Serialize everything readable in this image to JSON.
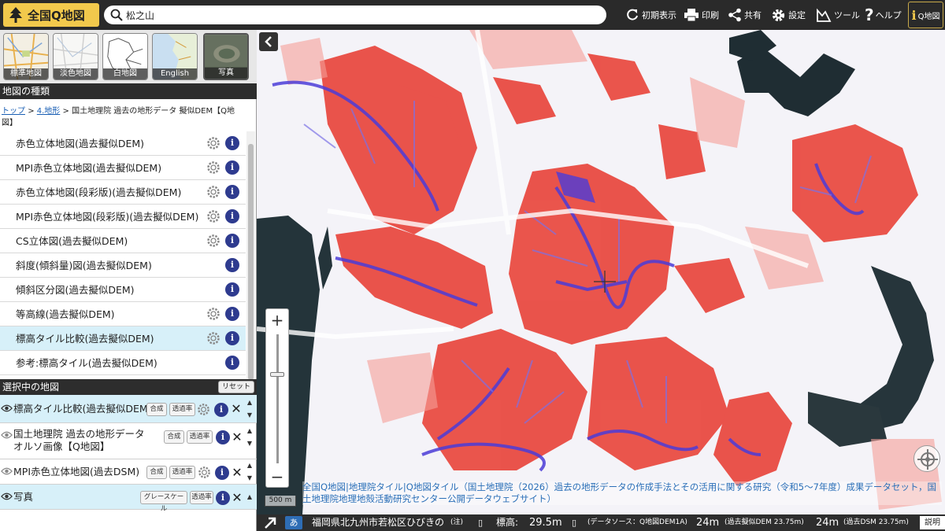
{
  "header": {
    "logo_label": "全国Q地図",
    "search_value": "松之山",
    "buttons": [
      {
        "label": "初期表示",
        "icon": "refresh-icon"
      },
      {
        "label": "印刷",
        "icon": "print-icon"
      },
      {
        "label": "共有",
        "icon": "share-icon"
      },
      {
        "label": "設定",
        "icon": "gear-icon"
      },
      {
        "label": "ツール",
        "icon": "tool-icon"
      },
      {
        "label": "ヘルプ",
        "icon": "help-icon"
      }
    ],
    "qchizu_label": "Q地図"
  },
  "base_maps": [
    {
      "label": "標準地図"
    },
    {
      "label": "淡色地図"
    },
    {
      "label": "白地図"
    },
    {
      "label": "English"
    },
    {
      "label": "写真"
    }
  ],
  "map_types": {
    "title": "地図の種類",
    "breadcrumb": {
      "top": "トップ",
      "sep1": ">",
      "cat": "4.地形",
      "sep2": ">",
      "current": "国土地理院 過去の地形データ 擬似DEM【Q地図】"
    },
    "items": [
      {
        "label": "赤色立体地図(過去擬似DEM)",
        "has_settings": true,
        "active": false
      },
      {
        "label": "MPI赤色立体地図(過去擬似DEM)",
        "has_settings": true,
        "active": false
      },
      {
        "label": "赤色立体地図(段彩版)(過去擬似DEM)",
        "has_settings": true,
        "active": false
      },
      {
        "label": "MPI赤色立体地図(段彩版)(過去擬似DEM)",
        "has_settings": true,
        "active": false
      },
      {
        "label": "CS立体図(過去擬似DEM)",
        "has_settings": true,
        "active": false
      },
      {
        "label": "斜度(傾斜量)図(過去擬似DEM)",
        "has_settings": false,
        "active": false
      },
      {
        "label": "傾斜区分図(過去擬似DEM)",
        "has_settings": false,
        "active": false
      },
      {
        "label": "等高線(過去擬似DEM)",
        "has_settings": true,
        "active": false
      },
      {
        "label": "標高タイル比較(過去擬似DEM)",
        "has_settings": true,
        "active": true
      },
      {
        "label": "参考:標高タイル(過去擬似DEM)",
        "has_settings": false,
        "active": false
      }
    ]
  },
  "selected_maps": {
    "title": "選択中の地図",
    "reset_label": "リセット",
    "items": [
      {
        "label": "標高タイル比較(過去擬似DEM)",
        "btn1": "合成",
        "btn2": "透過率"
      },
      {
        "label": "国土地理院 過去の地形データ",
        "label2": "オルソ画像【Q地図】",
        "btn1": "合成",
        "btn2": "透過率"
      },
      {
        "label": "MPI赤色立体地図(過去DSM)",
        "btn1": "合成",
        "btn2": "透過率"
      },
      {
        "label": "写真",
        "btn1": "グレースケール",
        "btn2": "透過率"
      }
    ]
  },
  "map": {
    "zoom_in": "+",
    "zoom_out": "−",
    "scale": "500 m",
    "attribution": "全国Q地図|地理院タイル|Q地図タイル（国土地理院（2026）過去の地形データの作成手法とその活用に関する研究（令和5〜7年度）成果データセット，国土地理院地理地殻活動研究センター公開データウェブサイト）"
  },
  "status": {
    "kana": "あ",
    "address": "福岡県北九州市若松区ひびきの",
    "address_note": "(注)",
    "elevation_label": "標高:",
    "elevation_value": "29.5m",
    "source": "(データソース：Q地図DEM1A)",
    "v1": "24m",
    "v1_note": "(過去擬似DEM 23.75m)",
    "v2": "24m",
    "v2_note": "(過去DSM 23.75m)",
    "explain": "説明"
  },
  "colors": {
    "header_bg": "#2a2a2a",
    "logo_bg": "#f2c94c",
    "active_item": "#d7f0f9",
    "info_blue": "#2e3b8f",
    "relief_red": "#e8382e",
    "relief_blue": "#4b3cd8",
    "water_dark": "#243036"
  }
}
